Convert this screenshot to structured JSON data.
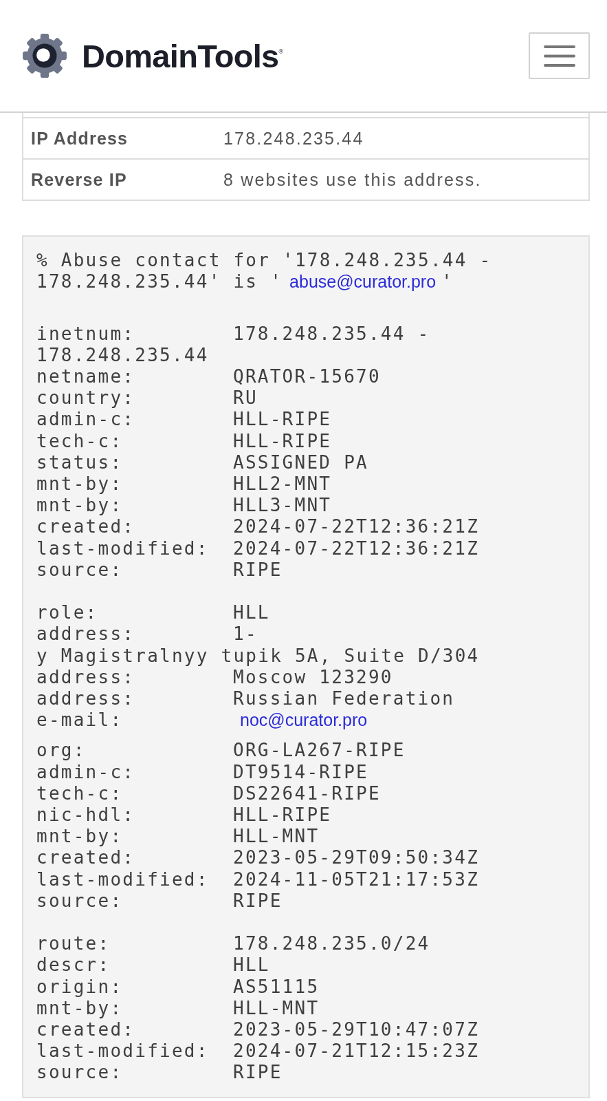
{
  "header": {
    "logo_text": "DomainTools$^{®}$"
  },
  "info_table": {
    "rows": [
      {
        "label": "IP Address",
        "value": "178.248.235.44"
      },
      {
        "label": "Reverse IP",
        "value": "8 websites use this address."
      }
    ]
  },
  "whois": {
    "abuse_notice": {
      "text_before": "% Abuse contact for '178.248.235.44 - 178.248.235.44' is '",
      "email": "abuse@curator.pro",
      "text_after": "'"
    },
    "blocks": [
      {
        "lines": [
          {
            "kind": "field",
            "key": "inetnum:",
            "value": "178.248.235.44 -"
          },
          {
            "kind": "continuation",
            "value": "178.248.235.44"
          },
          {
            "kind": "field",
            "key": "netname:",
            "value": "QRATOR-15670"
          },
          {
            "kind": "field",
            "key": "country:",
            "value": "RU"
          },
          {
            "kind": "field",
            "key": "admin-c:",
            "value": "HLL-RIPE"
          },
          {
            "kind": "field",
            "key": "tech-c:",
            "value": "HLL-RIPE"
          },
          {
            "kind": "field",
            "key": "status:",
            "value": "ASSIGNED PA"
          },
          {
            "kind": "field",
            "key": "mnt-by:",
            "value": "HLL2-MNT"
          },
          {
            "kind": "field",
            "key": "mnt-by:",
            "value": "HLL3-MNT"
          },
          {
            "kind": "field",
            "key": "created:",
            "value": "2024-07-22T12:36:21Z"
          },
          {
            "kind": "field",
            "key": "last-modified:",
            "value": "2024-07-22T12:36:21Z"
          },
          {
            "kind": "field",
            "key": "source:",
            "value": "RIPE"
          }
        ]
      },
      {
        "lines": [
          {
            "kind": "field",
            "key": "role:",
            "value": "HLL"
          },
          {
            "kind": "field",
            "key": "address:",
            "value": "1-"
          },
          {
            "kind": "continuation",
            "value": "y Magistralnyy tupik 5A, Suite D/304"
          },
          {
            "kind": "field",
            "key": "address:",
            "value": "Moscow 123290"
          },
          {
            "kind": "field",
            "key": "address:",
            "value": "Russian Federation"
          },
          {
            "kind": "email",
            "key": "e-mail:",
            "value": "noc@curator.pro"
          },
          {
            "kind": "field",
            "key": "org:",
            "value": "ORG-LA267-RIPE"
          },
          {
            "kind": "field",
            "key": "admin-c:",
            "value": "DT9514-RIPE"
          },
          {
            "kind": "field",
            "key": "tech-c:",
            "value": "DS22641-RIPE"
          },
          {
            "kind": "field",
            "key": "nic-hdl:",
            "value": "HLL-RIPE"
          },
          {
            "kind": "field",
            "key": "mnt-by:",
            "value": "HLL-MNT"
          },
          {
            "kind": "field",
            "key": "created:",
            "value": "2023-05-29T09:50:34Z"
          },
          {
            "kind": "field",
            "key": "last-modified:",
            "value": "2024-11-05T21:17:53Z"
          },
          {
            "kind": "field",
            "key": "source:",
            "value": "RIPE"
          }
        ]
      },
      {
        "lines": [
          {
            "kind": "field",
            "key": "route:",
            "value": "178.248.235.0/24"
          },
          {
            "kind": "field",
            "key": "descr:",
            "value": "HLL"
          },
          {
            "kind": "field",
            "key": "origin:",
            "value": "AS51115"
          },
          {
            "kind": "field",
            "key": "mnt-by:",
            "value": "HLL-MNT"
          },
          {
            "kind": "field",
            "key": "created:",
            "value": "2023-05-29T10:47:07Z"
          },
          {
            "kind": "field",
            "key": "last-modified:",
            "value": "2024-07-21T12:15:23Z"
          },
          {
            "kind": "field",
            "key": "source:",
            "value": "RIPE"
          }
        ]
      }
    ]
  }
}
